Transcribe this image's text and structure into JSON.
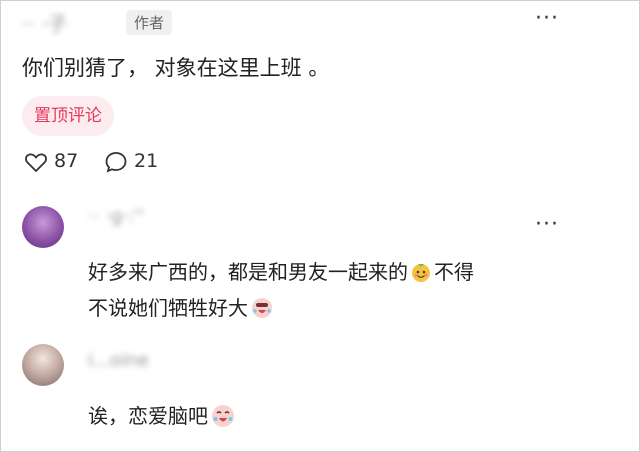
{
  "post": {
    "username": "·· ·子",
    "author_badge": "作者",
    "more": "···",
    "content": "你们别猜了， 对象在这里上班 。",
    "pinned_label": "置顶评论",
    "likes": "87",
    "comments": "21"
  },
  "replies": [
    {
      "username": "·· ·g·:''",
      "more": "···",
      "line1": "好多来广西的，都是和男友一起来的",
      "line1_end": "不得",
      "line2": "不说她们牺牲好大"
    },
    {
      "username": "i...oine",
      "line1": "诶，恋爱脑吧"
    }
  ],
  "icons": {
    "heart": "heart-icon",
    "comment": "comment-icon",
    "more": "more-dots-icon",
    "emoji_smile": "smile-emoji",
    "emoji_cry": "cry-emoji"
  }
}
